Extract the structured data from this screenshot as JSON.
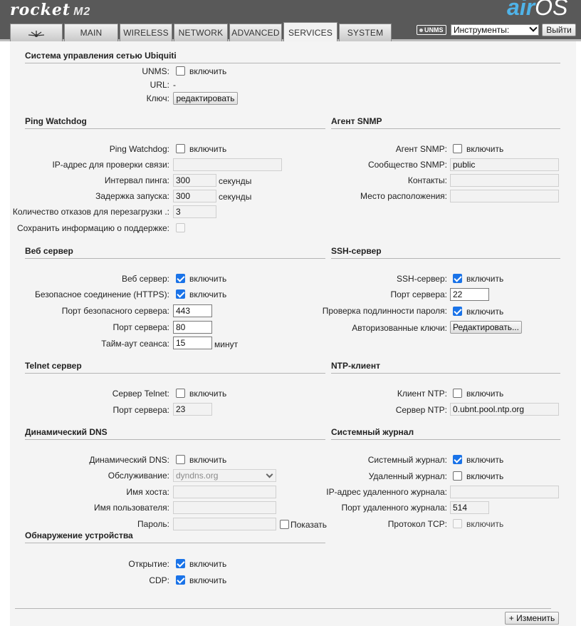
{
  "header": {
    "brand": "rocket",
    "model": "M2",
    "os_air": "air",
    "os_name": "OS",
    "tabs": {
      "main": "MAIN",
      "wireless": "WIRELESS",
      "network": "NETWORK",
      "advanced": "ADVANCED",
      "services": "SERVICES",
      "system": "SYSTEM"
    },
    "unms_badge": "UNMS",
    "tools_select": "Инструменты:",
    "logout": "Выйти"
  },
  "ubnt": {
    "title": "Система управления сетью Ubiquiti",
    "unms_label": "UNMS:",
    "unms_enable": "включить",
    "url_label": "URL:",
    "url_value": "-",
    "key_label": "Ключ:",
    "key_button": "редактировать"
  },
  "ping": {
    "title": "Ping Watchdog",
    "enabled_label": "Ping Watchdog:",
    "enable": "включить",
    "ip_label": "IP-адрес для проверки связи:",
    "ip_value": "",
    "interval_label": "Интервал пинга:",
    "interval_value": "300",
    "seconds": "секунды",
    "delay_label": "Задержка запуска:",
    "delay_value": "300",
    "delay_unit": "секунды",
    "failures_label": "Количество отказов для перезагрузки .:",
    "failures_value": "3",
    "support_label": "Сохранить информацию о поддержке:"
  },
  "snmp": {
    "title": "Агент SNMP",
    "agent_label": "Агент SNMP:",
    "enable": "включить",
    "community_label": "Сообщество SNMP:",
    "community_value": "public",
    "contacts_label": "Контакты:",
    "contacts_value": "",
    "location_label": "Место расположения:",
    "location_value": ""
  },
  "web": {
    "title": "Веб сервер",
    "server_label": "Веб сервер:",
    "enable": "включить",
    "https_label": "Безопасное соединение (HTTPS):",
    "https_enable": "включить",
    "secure_port_label": "Порт безопасного сервера:",
    "secure_port_value": "443",
    "port_label": "Порт сервера:",
    "port_value": "80",
    "timeout_label": "Тайм-аут сеанса:",
    "timeout_value": "15",
    "timeout_unit": "минут"
  },
  "ssh": {
    "title": "SSH-сервер",
    "server_label": "SSH-сервер:",
    "enable": "включить",
    "port_label": "Порт сервера:",
    "port_value": "22",
    "password_label": "Проверка подлинности пароля:",
    "password_enable": "включить",
    "keys_label": "Авторизованные ключи:",
    "keys_button": "Редактировать..."
  },
  "telnet": {
    "title": "Telnet сервер",
    "server_label": "Сервер Telnet:",
    "enable": "включить",
    "port_label": "Порт сервера:",
    "port_value": "23"
  },
  "ntp": {
    "title": "NTP-клиент",
    "client_label": "Клиент NTP:",
    "enable": "включить",
    "server_label": "Сервер NTP:",
    "server_value": "0.ubnt.pool.ntp.org"
  },
  "ddns": {
    "title": "Динамический DNS",
    "enabled_label": "Динамический DNS:",
    "enable": "включить",
    "service_label": "Обслуживание:",
    "service_value": "dyndns.org",
    "host_label": "Имя хоста:",
    "host_value": "",
    "user_label": "Имя пользователя:",
    "user_value": "",
    "password_label": "Пароль:",
    "password_value": "",
    "show_label": "Показать"
  },
  "syslog": {
    "title": "Системный журнал",
    "syslog_label": "Системный журнал:",
    "enable": "включить",
    "remote_label": "Удаленный журнал:",
    "remote_enable": "включить",
    "remote_ip_label": "IP-адрес удаленного журнала:",
    "remote_ip_value": "",
    "remote_port_label": "Порт удаленного журнала:",
    "remote_port_value": "514",
    "tcp_label": "Протокол TCP:",
    "tcp_enable": "включить"
  },
  "discovery": {
    "title": "Обнаружение устройства",
    "discovery_label": "Открытие:",
    "enable": "включить",
    "cdp_label": "CDP:",
    "cdp_enable": "включить"
  },
  "footer": {
    "change_button": "+ Изменить"
  }
}
